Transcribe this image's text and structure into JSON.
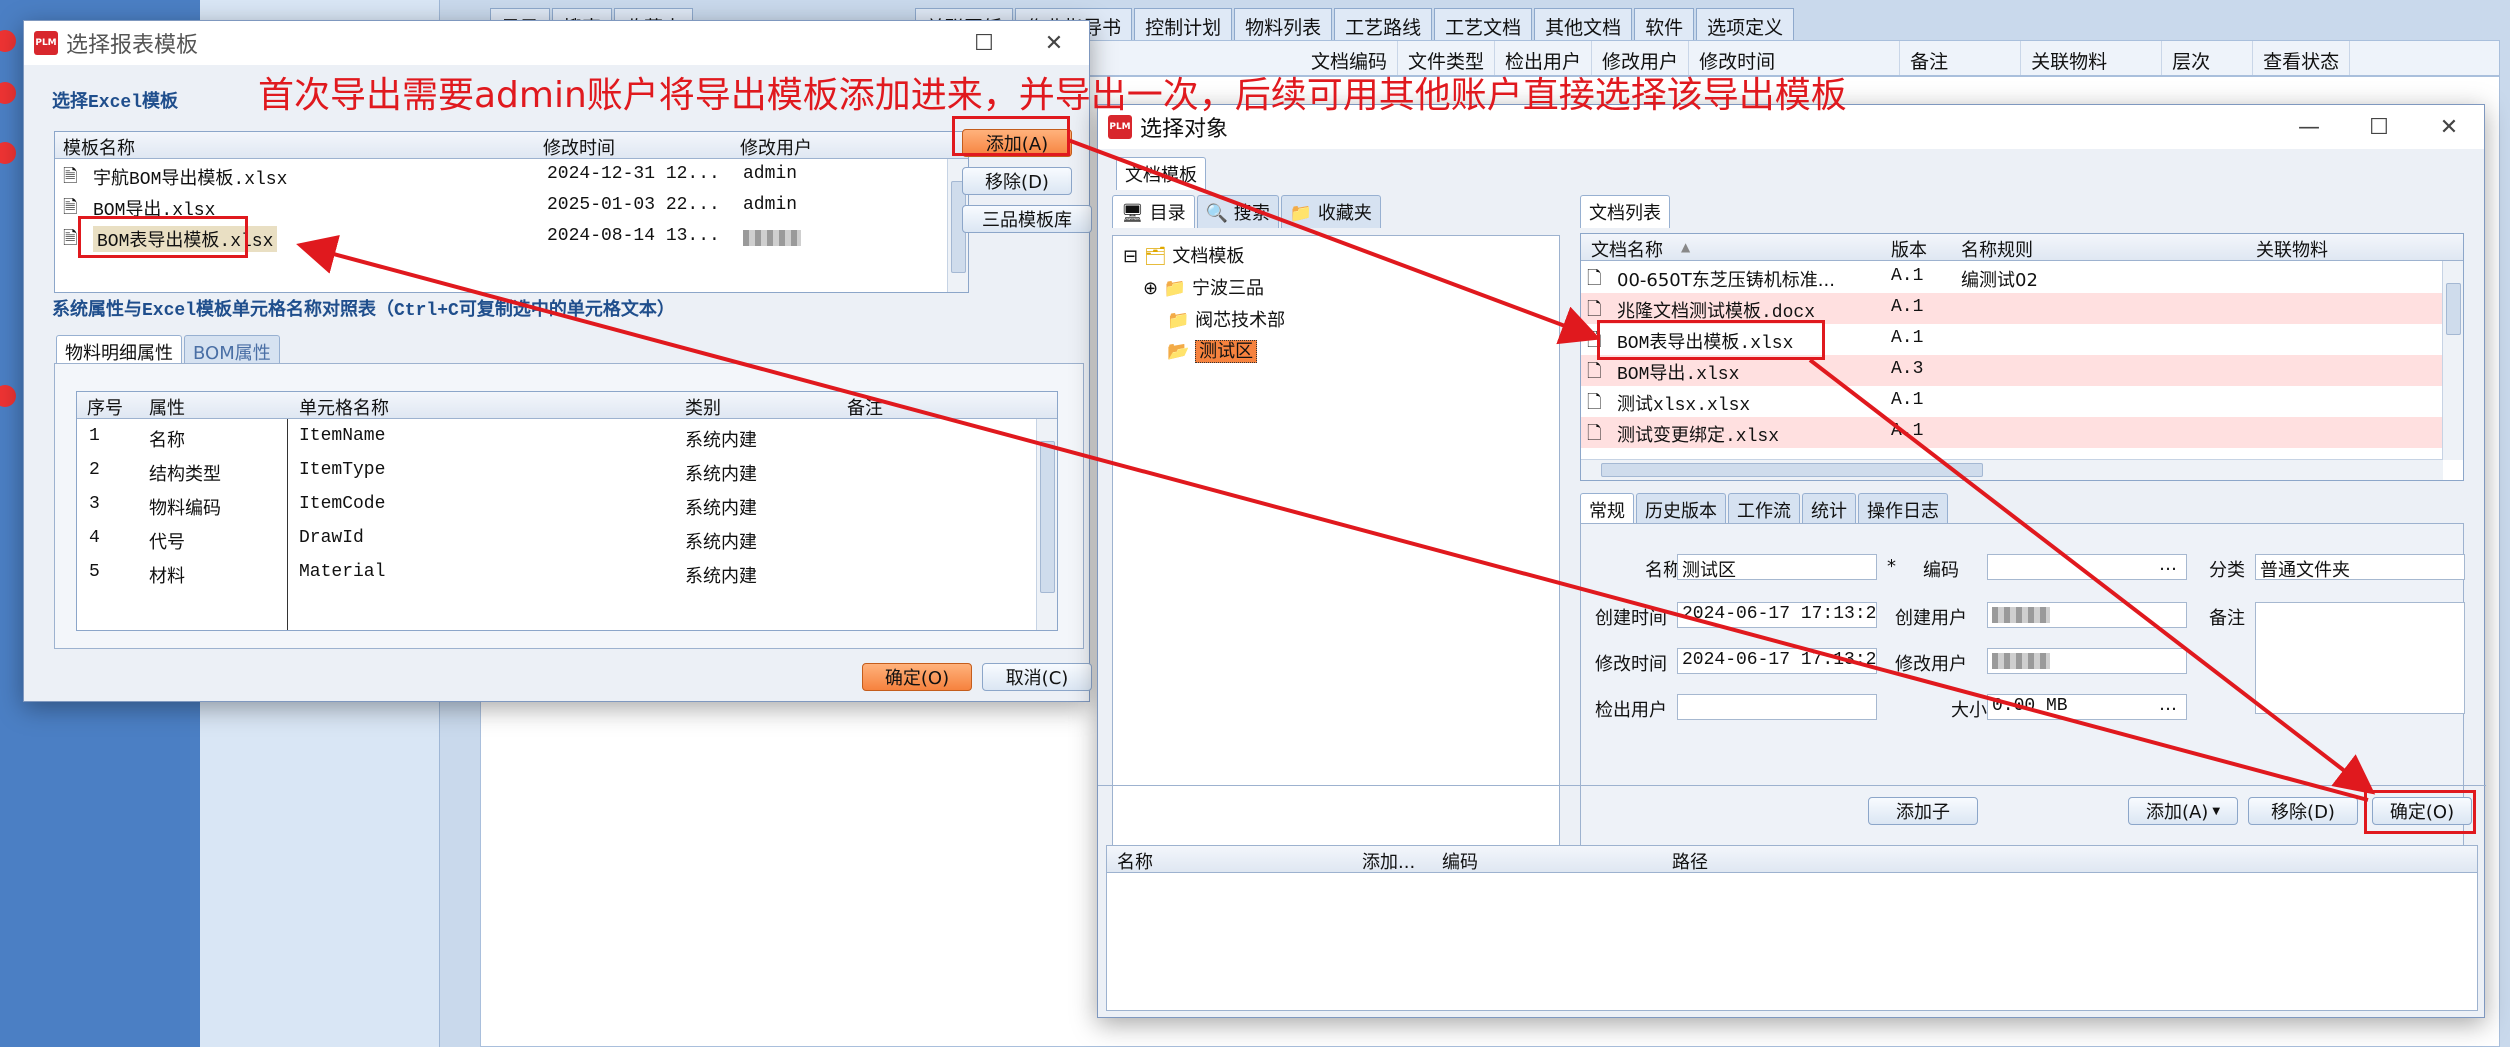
{
  "background": {
    "tabs": [
      "关联图纸",
      "作业指导书",
      "控制计划",
      "物料列表",
      "工艺路线",
      "工艺文档",
      "其他文档",
      "软件",
      "选项定义"
    ],
    "columns": [
      "文档编码",
      "文件类型",
      "检出用户",
      "修改用户",
      "修改时间",
      "备注",
      "关联物料",
      "层次",
      "查看状态"
    ],
    "left_tabs": [
      "目录",
      "搜索",
      "收藏夹"
    ]
  },
  "annotation": "首次导出需要admin账户将导出模板添加进来，并导出一次，后续可用其他账户直接选择该导出模板",
  "dialog1": {
    "title": "选择报表模板",
    "logo": "PLM",
    "section1": "选择Excel模板",
    "columns": [
      "模板名称",
      "修改时间",
      "修改用户"
    ],
    "rows": [
      {
        "name": "宇航BOM导出模板.xlsx",
        "time": "2024-12-31 12...",
        "user": "admin"
      },
      {
        "name": "BOM导出.xlsx",
        "time": "2025-01-03 22...",
        "user": "admin"
      },
      {
        "name": "BOM表导出模板.xlsx",
        "time": "2024-08-14 13...",
        "user": ""
      }
    ],
    "buttons": {
      "add": "添加(A)",
      "remove": "移除(D)",
      "lib": "三品模板库",
      "ok": "确定(O)",
      "cancel": "取消(C)"
    },
    "section2": "系统属性与Excel模板单元格名称对照表（Ctrl+C可复制选中的单元格文本）",
    "tabs": [
      "物料明细属性",
      "BOM属性"
    ],
    "attr_columns": [
      "序号",
      "属性",
      "单元格名称",
      "类别",
      "备注"
    ],
    "attr_rows": [
      {
        "no": "1",
        "attr": "名称",
        "cell": "ItemName",
        "cat": "系统内建"
      },
      {
        "no": "2",
        "attr": "结构类型",
        "cell": "ItemType",
        "cat": "系统内建"
      },
      {
        "no": "3",
        "attr": "物料编码",
        "cell": "ItemCode",
        "cat": "系统内建"
      },
      {
        "no": "4",
        "attr": "代号",
        "cell": "DrawId",
        "cat": "系统内建"
      },
      {
        "no": "5",
        "attr": "材料",
        "cell": "Material",
        "cat": "系统内建"
      }
    ]
  },
  "dialog2": {
    "title": "选择对象",
    "logo": "PLM",
    "top_tab": "文档模板",
    "nav_tabs": [
      "目录",
      "搜索",
      "收藏夹"
    ],
    "tree": {
      "root": "文档模板",
      "children": [
        "宁波三品",
        "阀芯技术部",
        "测试区"
      ]
    },
    "list_tab": "文档列表",
    "list_columns": [
      "文档名称",
      "版本",
      "名称规则",
      "关联物料"
    ],
    "list_rows": [
      {
        "name": "00-650T东芝压铸机标准...",
        "ver": "A.1",
        "rule": "编测试02"
      },
      {
        "name": "兆隆文档测试模板.docx",
        "ver": "A.1",
        "rule": ""
      },
      {
        "name": "BOM表导出模板.xlsx",
        "ver": "A.1",
        "rule": ""
      },
      {
        "name": "BOM导出.xlsx",
        "ver": "A.3",
        "rule": ""
      },
      {
        "name": "测试xlsx.xlsx",
        "ver": "A.1",
        "rule": ""
      },
      {
        "name": "测试变更绑定.xlsx",
        "ver": "A.1",
        "rule": ""
      }
    ],
    "detail_tabs": [
      "常规",
      "历史版本",
      "工作流",
      "统计",
      "操作日志"
    ],
    "form": {
      "name_label": "名称",
      "name_value": "测试区",
      "required": "*",
      "code_label": "编码",
      "code_value": "",
      "category_label": "分类",
      "category_value": "普通文件夹",
      "created_label": "创建时间",
      "created_value": "2024-06-17 17:13:23",
      "creator_label": "创建用户",
      "remark_label": "备注",
      "modified_label": "修改时间",
      "modified_value": "2024-06-17 17:13:23",
      "modifier_label": "修改用户",
      "checkout_label": "检出用户",
      "checkout_value": "",
      "size_label": "大小",
      "size_value": "0.00 MB"
    },
    "buttons": {
      "add_child": "添加子",
      "add": "添加(A)",
      "remove": "移除(D)",
      "ok": "确定(O)"
    },
    "bottom_columns": [
      "名称",
      "添加...",
      "编码",
      "路径"
    ]
  },
  "colors": {
    "annotation": "#e0191e",
    "orange_button": "#f6823e",
    "highlight_row": "#ffe0e0"
  }
}
